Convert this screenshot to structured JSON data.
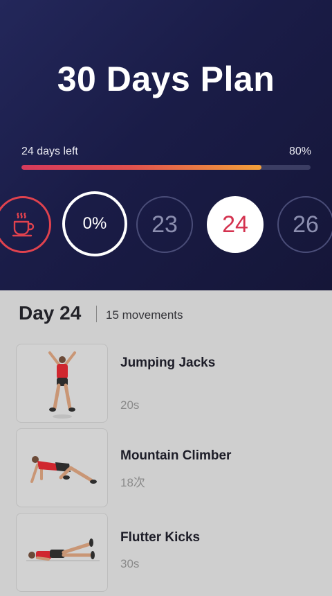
{
  "header": {
    "title": "30 Days Plan",
    "days_left": "24 days left",
    "progress_percent": "80%",
    "progress_fraction": 0.83
  },
  "day_selector": {
    "progress_label": "0%",
    "days": [
      "23",
      "24",
      "26"
    ],
    "selected_day": "24",
    "rest_icon": "coffee-cup-icon"
  },
  "day_info": {
    "title": "Day 24",
    "movements": "15 movements"
  },
  "exercises": [
    {
      "name": "Jumping Jacks",
      "duration": "20s",
      "icon": "jumping-jacks-figure"
    },
    {
      "name": "Mountain Climber",
      "duration": "18次",
      "icon": "mountain-climber-figure"
    },
    {
      "name": "Flutter Kicks",
      "duration": "30s",
      "icon": "flutter-kicks-figure"
    }
  ],
  "colors": {
    "header_bg": "#1a1c47",
    "accent_red": "#d4324f",
    "progress_end": "#f2a03a",
    "body_bg": "#cfcfcf"
  }
}
